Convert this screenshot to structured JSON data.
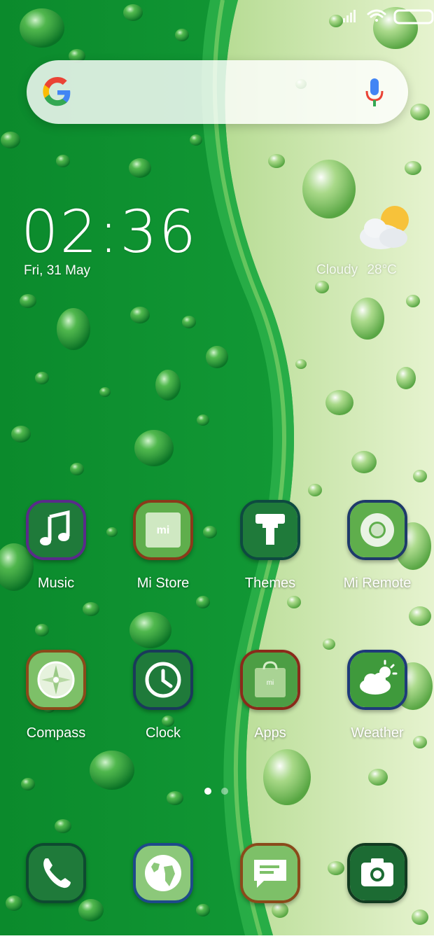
{
  "status": {
    "icons": [
      "signal-icon",
      "wifi-icon",
      "battery-icon"
    ]
  },
  "search": {
    "icons": [
      "google-logo",
      "mic-icon"
    ]
  },
  "clock": {
    "time": "02:36",
    "date": "Fri, 31 May"
  },
  "weather": {
    "condition": "Cloudy",
    "temperature": "28°C",
    "icon": "cloudy-sun-icon"
  },
  "apps": [
    {
      "label": "Music",
      "icon": "music-note-icon",
      "border": "#5a2b8a",
      "fill": "#1f7a3a"
    },
    {
      "label": "Mi Store",
      "icon": "mi-store-icon",
      "border": "#8a3a1a",
      "fill": "#5fae4c"
    },
    {
      "label": "Themes",
      "icon": "paint-roller-icon",
      "border": "#0e4a40",
      "fill": "#1f7a3a"
    },
    {
      "label": "Mi Remote",
      "icon": "remote-icon",
      "border": "#1e3a6a",
      "fill": "#5fae4c"
    },
    {
      "label": "Compass",
      "icon": "compass-icon",
      "border": "#8a4a1a",
      "fill": "#7dc068"
    },
    {
      "label": "Clock",
      "icon": "clock-icon",
      "border": "#1a3a5a",
      "fill": "#1f7a3a"
    },
    {
      "label": "Apps",
      "icon": "shopping-bag-icon",
      "border": "#8a2a1a",
      "fill": "#4c9e44"
    },
    {
      "label": "Weather",
      "icon": "weather-icon",
      "border": "#1e3a7a",
      "fill": "#3f9a3c"
    }
  ],
  "dock": [
    {
      "icon": "phone-icon",
      "border": "#0e4a30",
      "fill": "#1f7a3a"
    },
    {
      "icon": "browser-globe-icon",
      "border": "#1e4a8a",
      "fill": "#8cc87a"
    },
    {
      "icon": "messages-icon",
      "border": "#8a4a1a",
      "fill": "#7dc068"
    },
    {
      "icon": "camera-icon",
      "border": "#123a20",
      "fill": "#1c6b33"
    }
  ],
  "page_indicator": {
    "pages": 2,
    "current": 1
  },
  "colors": {
    "dark_green": "#0f8a2e",
    "light_green": "#d8ecb8",
    "text": "#ffffff"
  }
}
